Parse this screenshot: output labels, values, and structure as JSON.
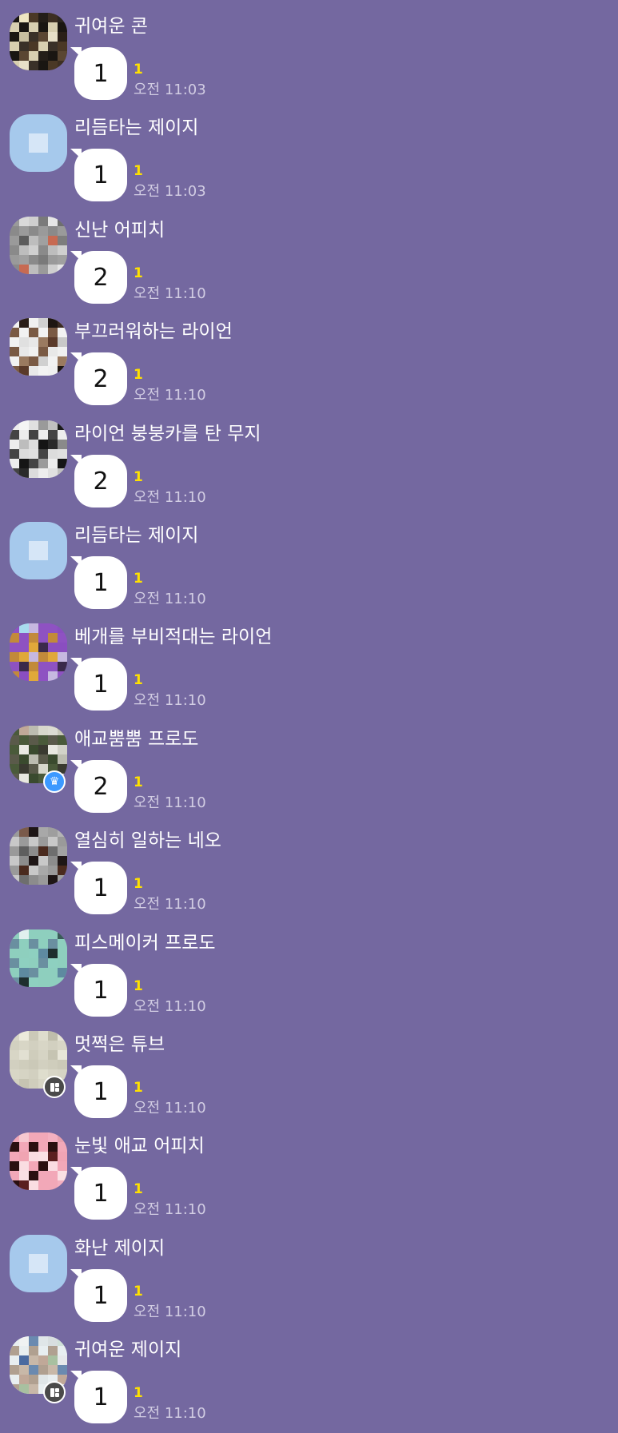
{
  "messages": [
    {
      "sender": "귀여운 콘",
      "text": "1",
      "unread": "1",
      "time": "오전 11:03"
    },
    {
      "sender": "리듬타는 제이지",
      "text": "1",
      "unread": "1",
      "time": "오전 11:03"
    },
    {
      "sender": "신난 어피치",
      "text": "2",
      "unread": "1",
      "time": "오전 11:10"
    },
    {
      "sender": "부끄러워하는 라이언",
      "text": "2",
      "unread": "1",
      "time": "오전 11:10"
    },
    {
      "sender": "라이언 붕붕카를 탄 무지",
      "text": "2",
      "unread": "1",
      "time": "오전 11:10"
    },
    {
      "sender": "리듬타는 제이지",
      "text": "1",
      "unread": "1",
      "time": "오전 11:10"
    },
    {
      "sender": "베개를 부비적대는 라이언",
      "text": "1",
      "unread": "1",
      "time": "오전 11:10"
    },
    {
      "sender": "애교뿜뿜 프로도",
      "text": "2",
      "unread": "1",
      "time": "오전 11:10"
    },
    {
      "sender": "열심히 일하는 네오",
      "text": "1",
      "unread": "1",
      "time": "오전 11:10"
    },
    {
      "sender": "피스메이커 프로도",
      "text": "1",
      "unread": "1",
      "time": "오전 11:10"
    },
    {
      "sender": "멋쩍은 튜브",
      "text": "1",
      "unread": "1",
      "time": "오전 11:10"
    },
    {
      "sender": "눈빛 애교 어피치",
      "text": "1",
      "unread": "1",
      "time": "오전 11:10"
    },
    {
      "sender": "화난 제이지",
      "text": "1",
      "unread": "1",
      "time": "오전 11:10"
    },
    {
      "sender": "귀여운 제이지",
      "text": "1",
      "unread": "1",
      "time": "오전 11:10"
    }
  ],
  "avatars": [
    {
      "type": "pixel",
      "badge": "",
      "colors": [
        "#1a1612",
        "#2c2620",
        "#3a3128",
        "#241e18",
        "#e8e0c8",
        "#efe6c2",
        "#d8cfb0",
        "#c9c0a0",
        "#3d2f22",
        "#5a4632",
        "#4a3826",
        "#2a2018"
      ]
    },
    {
      "type": "plain",
      "badge": "",
      "colors": [
        "#a6c9ec"
      ]
    },
    {
      "type": "pixel",
      "badge": "",
      "colors": [
        "#9a9a9a",
        "#6e6e6e",
        "#bdbdbd",
        "#7a7a7a",
        "#c76a52",
        "#d9d9d9",
        "#8a8a8a",
        "#5c5c5c",
        "#e6e6e6",
        "#a0a0a0",
        "#cfcfcf",
        "#7d7d7d"
      ]
    },
    {
      "type": "pixel",
      "badge": "",
      "colors": [
        "#f2f2f2",
        "#3a2a22",
        "#e8e8e8",
        "#d0d0d0",
        "#5a3a2a",
        "#2a1e18",
        "#7a5a44",
        "#e0e0e0",
        "#1e1612",
        "#9a7a60",
        "#f0f0f0",
        "#c8c8c8"
      ]
    },
    {
      "type": "pixel",
      "badge": "",
      "colors": [
        "#ededed",
        "#1a1a1a",
        "#dcdcdc",
        "#9a9a9a",
        "#2a2a2a",
        "#f5f5f5",
        "#444444",
        "#bdbdbd",
        "#c0c0c0",
        "#151515",
        "#e0e0e0",
        "#8a8a8a"
      ]
    },
    {
      "type": "plain",
      "badge": "",
      "colors": [
        "#a6c9ec"
      ]
    },
    {
      "type": "pixel",
      "badge": "",
      "colors": [
        "#8e52c2",
        "#8a4ec0",
        "#e0a83a",
        "#8e52c2",
        "#8a4ec0",
        "#a8dcee",
        "#c28a3a",
        "#8e52c2",
        "#8e52c2",
        "#3a2a4a",
        "#c6b8e0",
        "#8a4ec0"
      ]
    },
    {
      "type": "pixel",
      "badge": "crown",
      "colors": [
        "#4a5a3a",
        "#c8c8b8",
        "#3a4a2e",
        "#d8d8cc",
        "#e8e8e0",
        "#c0a898",
        "#5a5a4a",
        "#eaeae4",
        "#dcdcd2",
        "#3a3a30",
        "#bcbcb0",
        "#d2d2c8"
      ]
    },
    {
      "type": "pixel",
      "badge": "",
      "colors": [
        "#9a9a9a",
        "#b4b4b4",
        "#8c8c8c",
        "#a8a8a8",
        "#6e6e6e",
        "#7a5a4a",
        "#c8c8c8",
        "#5e5e5e",
        "#9e9e9e",
        "#4a2a1e",
        "#1e1616",
        "#a2a2a2"
      ]
    },
    {
      "type": "pixel",
      "badge": "",
      "colors": [
        "#8ecfbe",
        "#3a5a58",
        "#8ed0c0",
        "#8ecfbe",
        "#1e2e2e",
        "#e0f0ee",
        "#6a8fa0",
        "#8ecfbe",
        "#8ecfbe",
        "#5e8aa0",
        "#8ecfbe",
        "#8ecfbe"
      ]
    },
    {
      "type": "pixel",
      "badge": "board",
      "colors": [
        "#d8d6c6",
        "#e6e4d6",
        "#cfcdbc",
        "#deddcd",
        "#c6c4b2",
        "#eceadc",
        "#d2d0c0",
        "#e2e0d2",
        "#bfbdab",
        "#d6d4c4",
        "#cbc9b8",
        "#e8e6d8"
      ]
    },
    {
      "type": "pixel",
      "badge": "",
      "colors": [
        "#f2a8b8",
        "#e8a0ae",
        "#fadde2",
        "#f2a8b8",
        "#5a2020",
        "#f6c8d0",
        "#2a1010",
        "#f0a4b2",
        "#f4b0c0",
        "#fae0e4",
        "#f2a8b8",
        "#f0a4b4"
      ]
    },
    {
      "type": "plain",
      "badge": "",
      "colors": [
        "#a6c9ec"
      ]
    },
    {
      "type": "pixel",
      "badge": "board",
      "colors": [
        "#e8eef0",
        "#d0e0d8",
        "#c8b8a8",
        "#e0e6e8",
        "#a8c0a0",
        "#f0f2f2",
        "#b0a090",
        "#4a6aa0",
        "#d8dedf",
        "#c0a898",
        "#6a8ab0",
        "#e6e8ea"
      ]
    }
  ]
}
